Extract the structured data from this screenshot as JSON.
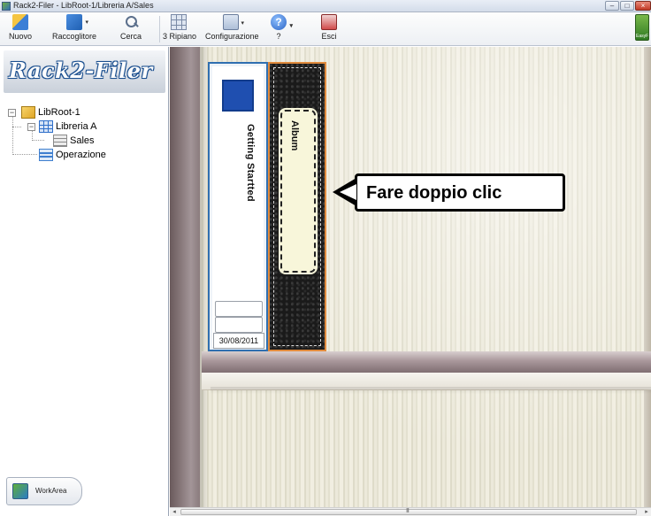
{
  "window": {
    "title": "Rack2-Filer - LibRoot-1/Libreria A/Sales",
    "minimize_icon": "minimize-icon",
    "maximize_icon": "maximize-icon",
    "close_icon": "close-icon"
  },
  "toolbar": {
    "items": [
      {
        "label": "Nuovo",
        "icon": "new-file-icon"
      },
      {
        "label": "Raccoglitore",
        "icon": "binder-icon"
      },
      {
        "label": "Cerca",
        "icon": "search-icon"
      },
      {
        "label": "3 Ripiano",
        "icon": "shelf-grid-icon"
      },
      {
        "label": "Configurazione",
        "icon": "settings-icon"
      },
      {
        "label": "?",
        "icon": "help-icon"
      },
      {
        "label": "Esci",
        "icon": "exit-icon"
      }
    ],
    "easy_label": "EasyF"
  },
  "sidebar": {
    "logo": "Rack2-Filer",
    "tree": [
      {
        "label": "LibRoot-1",
        "icon": "root-folder-icon"
      },
      {
        "label": "Libreria A",
        "icon": "library-icon"
      },
      {
        "label": "Sales",
        "icon": "shelf-icon"
      },
      {
        "label": "Operazione",
        "icon": "operation-icon"
      }
    ],
    "workarea_label": "WorkArea"
  },
  "shelf": {
    "binders": [
      {
        "title": "Getting Startted",
        "date": "30/08/2011",
        "color": "#1f4fb0"
      },
      {
        "title": "Album",
        "color": "#1a1a1a"
      }
    ],
    "callout": "Fare doppio clic"
  },
  "scrollbar": {
    "grip": "III"
  }
}
